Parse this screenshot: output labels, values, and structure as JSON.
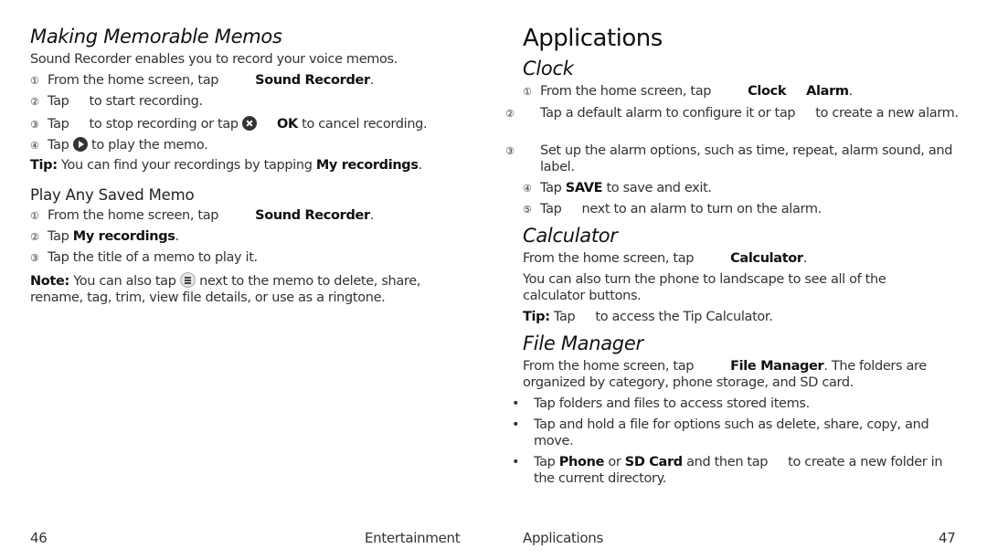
{
  "left_page": {
    "title": "Making Memorable Memos",
    "intro": "Sound Recorder enables you to record your voice memos.",
    "steps": [
      {
        "num": "①",
        "pre": "From the home screen, tap",
        "bold": "Sound Recorder",
        "post": "."
      },
      {
        "num": "②",
        "pre": "Tap",
        "post": "to start recording."
      },
      {
        "num": "③",
        "pre": "Tap",
        "mid": "to stop recording or tap",
        "bold": "OK",
        "post": "to cancel recording."
      },
      {
        "num": "④",
        "pre": "Tap",
        "post": "to play the memo."
      }
    ],
    "tip": {
      "label": "Tip:",
      "text": "You can find your recordings by tapping",
      "bold": "My recordings",
      "post": "."
    },
    "subsection": {
      "title": "Play Any Saved Memo",
      "steps": [
        {
          "num": "①",
          "pre": "From the home screen, tap",
          "bold": "Sound Recorder",
          "post": "."
        },
        {
          "num": "②",
          "pre": "Tap",
          "bold": "My recordings",
          "post": "."
        },
        {
          "num": "③",
          "pre": "Tap the title of a memo to play it."
        }
      ],
      "note": {
        "label": "Note:",
        "pre": "You can also tap",
        "post": "next to the memo to delete, share, rename, tag, trim, view file details, or use as a ringtone."
      }
    },
    "footer": {
      "page_number": "46",
      "section": "Entertainment"
    }
  },
  "right_page": {
    "title": "Applications",
    "clock": {
      "title": "Clock",
      "steps": [
        {
          "num": "①",
          "pre": "From the home screen, tap",
          "bold1": "Clock",
          "bold2": "Alarm",
          "post": "."
        },
        {
          "num": "②",
          "pre": "Tap a default alarm to configure it or tap",
          "post": "to create a new alarm."
        },
        {
          "num": "③",
          "pre": "Set up the alarm options, such as time, repeat, alarm sound, and label."
        },
        {
          "num": "④",
          "pre": "Tap",
          "bold": "SAVE",
          "post": "to save and exit."
        },
        {
          "num": "⑤",
          "pre": "Tap",
          "post": "next to an alarm to turn on the alarm."
        }
      ]
    },
    "calculator": {
      "title": "Calculator",
      "line1_pre": "From the home screen, tap",
      "line1_bold": "Calculator",
      "line1_post": ".",
      "line2": "You can also turn the phone to landscape to see all of the calculator buttons.",
      "tip_label": "Tip:",
      "tip_pre": "Tap",
      "tip_post": "to access the Tip Calculator."
    },
    "file_manager": {
      "title": "File Manager",
      "intro_pre": "From the home screen, tap",
      "intro_bold": "File Manager",
      "intro_post": ". The folders are organized by category, phone storage, and SD card.",
      "bullets": [
        {
          "text": "Tap folders and files to access stored items."
        },
        {
          "text": "Tap and hold a file for options such as delete, share, copy, and move."
        },
        {
          "pre": "Tap",
          "bold1": "Phone",
          "mid": "or",
          "bold2": "SD Card",
          "mid2": "and then tap",
          "post": "to create a new folder in the current directory."
        }
      ]
    },
    "footer": {
      "section": "Applications",
      "page_number": "47"
    }
  }
}
